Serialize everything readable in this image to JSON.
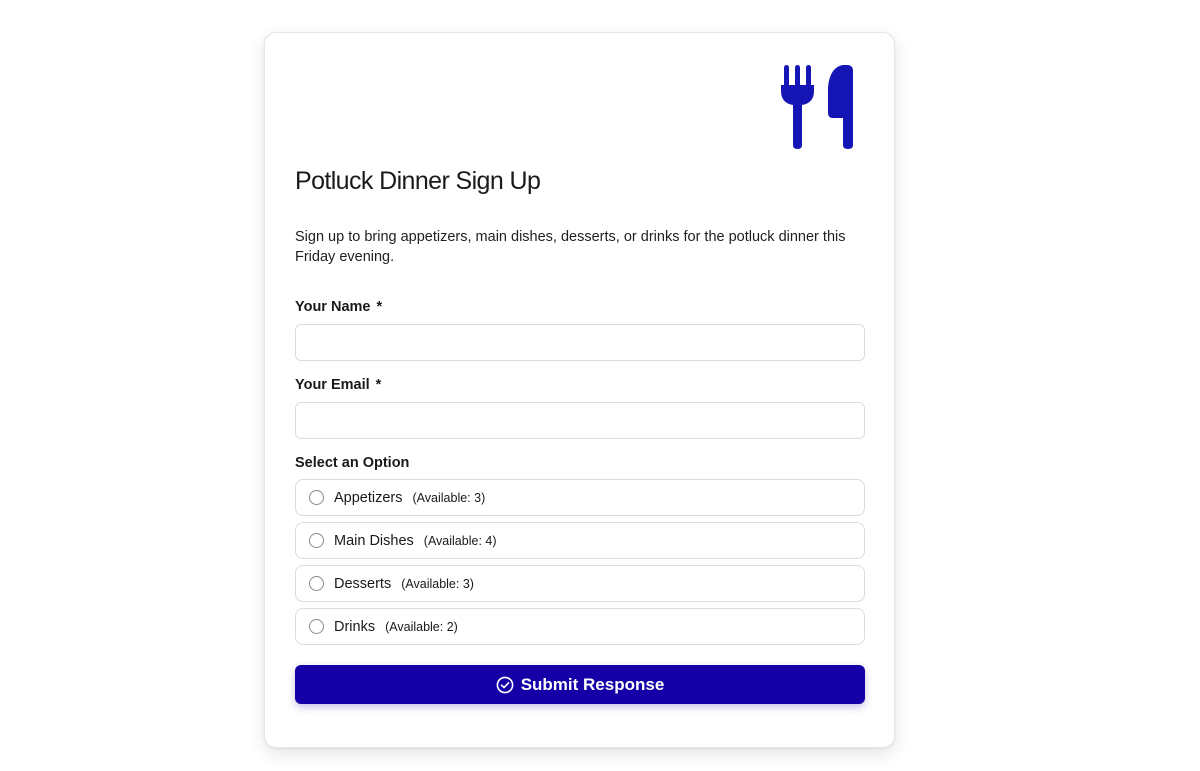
{
  "form": {
    "title": "Potluck Dinner Sign Up",
    "description": "Sign up to bring appetizers, main dishes, desserts, or drinks for the potluck dinner this Friday evening.",
    "logo_icon": "fork-knife-icon",
    "accent_color": "#1500a8",
    "name_field": {
      "label": "Your Name",
      "required_mark": "*",
      "value": "",
      "placeholder": ""
    },
    "email_field": {
      "label": "Your Email",
      "required_mark": "*",
      "value": "",
      "placeholder": ""
    },
    "option_group_label": "Select an Option",
    "options": [
      {
        "label": "Appetizers",
        "availability": "(Available: 3)",
        "selected": false
      },
      {
        "label": "Main Dishes",
        "availability": "(Available: 4)",
        "selected": false
      },
      {
        "label": "Desserts",
        "availability": "(Available: 3)",
        "selected": false
      },
      {
        "label": "Drinks",
        "availability": "(Available: 2)",
        "selected": false
      }
    ],
    "submit_label": "Submit Response",
    "submit_icon": "check-circle-icon"
  }
}
